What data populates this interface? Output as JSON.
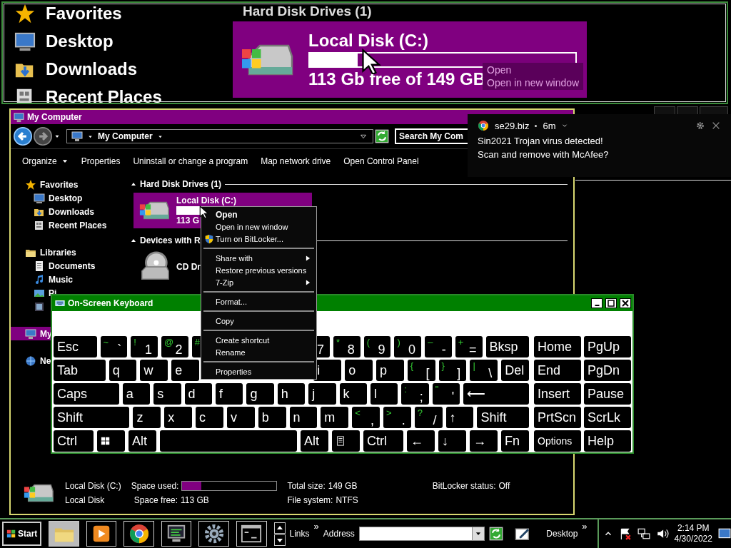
{
  "magnifier": {
    "sidebar": [
      {
        "label": "Favorites",
        "kind": "star"
      },
      {
        "label": "Desktop",
        "kind": "desktop"
      },
      {
        "label": "Downloads",
        "kind": "downloads"
      },
      {
        "label": "Recent Places",
        "kind": "recent"
      }
    ],
    "group": "Hard Disk Drives (1)",
    "drive": {
      "name": "Local Disk (C:)",
      "level": 0.18,
      "free": "113 Gb free of 149 GB"
    },
    "ghost_menu": [
      "Open",
      "Open in new window"
    ]
  },
  "explorer": {
    "title": "My Computer",
    "address": "My Computer",
    "search": {
      "placeholder": "Search My Com"
    },
    "toolbar": [
      {
        "label": "Organize",
        "dropdown": true
      },
      {
        "label": "Properties",
        "dropdown": false
      },
      {
        "label": "Uninstall or change a program",
        "dropdown": false
      },
      {
        "label": "Map network drive",
        "dropdown": false
      },
      {
        "label": "Open Control Panel",
        "dropdown": false
      }
    ],
    "sidebar": [
      {
        "label": "Favorites",
        "kind": "star",
        "selected": false,
        "children": [
          {
            "label": "Desktop",
            "kind": "desktop",
            "selected": false
          },
          {
            "label": "Downloads",
            "kind": "downloads",
            "selected": false
          },
          {
            "label": "Recent Places",
            "kind": "recent",
            "selected": false
          }
        ]
      },
      {
        "label": "Libraries",
        "kind": "libraries",
        "selected": false,
        "children": [
          {
            "label": "Documents",
            "kind": "documents",
            "selected": false
          },
          {
            "label": "Music",
            "kind": "music",
            "selected": false
          },
          {
            "label": "Pi",
            "kind": "pictures",
            "selected": false
          },
          {
            "kind": "videos",
            "selected": false
          }
        ]
      },
      {
        "label": "My",
        "kind": "computer",
        "selected": true
      },
      {
        "label": "Ne",
        "kind": "network",
        "selected": false
      }
    ],
    "groups": [
      {
        "title": "Hard Disk Drives (1)",
        "items": [
          {
            "name": "Local Disk (C:)",
            "kind": "hdd",
            "selected": true,
            "level": 0.2,
            "free": "113 G"
          }
        ]
      },
      {
        "title": "Devices with R",
        "items": [
          {
            "name": "CD Dr",
            "kind": "cd",
            "selected": false
          }
        ]
      }
    ],
    "details": {
      "name": "Local Disk (C:)",
      "type": "Local Disk",
      "used_label": "Space used:",
      "level": 0.2,
      "free_label": "Space free:",
      "free": "113 GB",
      "total_label": "Total size:",
      "total": "149 GB",
      "fs_label": "File system:",
      "fs": "NTFS",
      "bitlocker_label": "BitLocker status:",
      "bitlocker": "Off"
    }
  },
  "notification": {
    "source": "se29.biz",
    "time": "6m",
    "lines": [
      "Sin2021 Trojan virus detected!",
      "Scan and remove with McAfee?"
    ]
  },
  "context_menu": [
    [
      {
        "label": "Open",
        "bold": true,
        "submenu": false,
        "kind": "plain"
      },
      {
        "label": "Open in new window",
        "bold": false,
        "submenu": false,
        "kind": "plain"
      },
      {
        "label": "Turn on BitLocker...",
        "bold": false,
        "submenu": false,
        "kind": "shield"
      }
    ],
    [
      {
        "label": "Share with",
        "bold": false,
        "submenu": true,
        "kind": "plain"
      },
      {
        "label": "Restore previous versions",
        "bold": false,
        "submenu": false,
        "kind": "plain"
      },
      {
        "label": "7-Zip",
        "bold": false,
        "submenu": true,
        "kind": "plain"
      }
    ],
    [
      {
        "label": "Format...",
        "bold": false,
        "submenu": false,
        "kind": "plain"
      }
    ],
    [
      {
        "label": "Copy",
        "bold": false,
        "submenu": false,
        "kind": "plain"
      }
    ],
    [
      {
        "label": "Create shortcut",
        "bold": false,
        "submenu": false,
        "kind": "plain"
      },
      {
        "label": "Rename",
        "bold": false,
        "submenu": false,
        "kind": "plain"
      }
    ],
    [
      {
        "label": "Properties",
        "bold": false,
        "submenu": false,
        "kind": "plain"
      }
    ]
  ],
  "keyboard": {
    "title": "On-Screen Keyboard",
    "rows": [
      {
        "keys": [
          {
            "label": "Esc",
            "kind": "wide"
          },
          {
            "label": "`",
            "shift": "~",
            "kind": "key"
          },
          {
            "label": "1",
            "shift": "!",
            "kind": "key"
          },
          {
            "label": "2",
            "shift": "@",
            "kind": "key"
          },
          {
            "shift": "#",
            "kind": "key"
          },
          {
            "kind": "covered"
          },
          {
            "kind": "covered"
          },
          {
            "kind": "covered"
          },
          {
            "label": "7",
            "kind": "shifted"
          },
          {
            "label": "8",
            "shift": "*",
            "kind": "key"
          },
          {
            "label": "9",
            "shift": "(",
            "kind": "key"
          },
          {
            "label": "0",
            "shift": ")",
            "kind": "key"
          },
          {
            "label": "-",
            "shift": "–",
            "kind": "key"
          },
          {
            "label": "=",
            "shift": "+",
            "kind": "key"
          },
          {
            "label": "Bksp",
            "kind": "wide"
          }
        ]
      },
      {
        "keys": [
          {
            "label": "Tab",
            "kind": "tab"
          },
          {
            "label": "q",
            "kind": "key"
          },
          {
            "label": "w",
            "kind": "key"
          },
          {
            "label": "e",
            "kind": "key"
          },
          {
            "kind": "covered"
          },
          {
            "kind": "covered"
          },
          {
            "kind": "covered"
          },
          {
            "kind": "covered"
          },
          {
            "label": "i",
            "kind": "key"
          },
          {
            "label": "o",
            "kind": "key"
          },
          {
            "label": "p",
            "kind": "key"
          },
          {
            "label": "[",
            "shift": "{",
            "kind": "key"
          },
          {
            "label": "]",
            "shift": "}",
            "kind": "key"
          },
          {
            "label": "\\",
            "shift": "|",
            "kind": "key"
          },
          {
            "label": "Del",
            "kind": "key"
          }
        ]
      },
      {
        "keys": [
          {
            "label": "Caps",
            "kind": "caps"
          },
          {
            "label": "a",
            "kind": "key"
          },
          {
            "label": "s",
            "kind": "key"
          },
          {
            "label": "d",
            "kind": "key"
          },
          {
            "label": "f",
            "kind": "key"
          },
          {
            "label": "g",
            "kind": "key"
          },
          {
            "label": "h",
            "kind": "key"
          },
          {
            "label": "j",
            "kind": "key"
          },
          {
            "label": "k",
            "kind": "key"
          },
          {
            "label": "l",
            "kind": "key"
          },
          {
            "label": ";",
            "shift": ":",
            "kind": "key"
          },
          {
            "label": "'",
            "shift": "\"",
            "kind": "key"
          },
          {
            "label": "⟵",
            "kind": "caps"
          }
        ]
      },
      {
        "keys": [
          {
            "label": "Shift",
            "kind": "lshift"
          },
          {
            "label": "z",
            "kind": "key"
          },
          {
            "label": "x",
            "kind": "key"
          },
          {
            "label": "c",
            "kind": "key"
          },
          {
            "label": "v",
            "kind": "key"
          },
          {
            "label": "b",
            "kind": "key"
          },
          {
            "label": "n",
            "kind": "key"
          },
          {
            "label": "m",
            "kind": "key"
          },
          {
            "label": ",",
            "shift": "<",
            "kind": "key"
          },
          {
            "label": ".",
            "shift": ">",
            "kind": "key"
          },
          {
            "label": "/",
            "shift": "?",
            "kind": "key"
          },
          {
            "label": "↑",
            "kind": "key"
          },
          {
            "label": "Shift",
            "kind": "rshift"
          }
        ]
      },
      {
        "keys": [
          {
            "label": "Ctrl",
            "kind": "mid"
          },
          {
            "kind": "windows"
          },
          {
            "label": "Alt",
            "kind": "key"
          },
          {
            "kind": "space"
          },
          {
            "label": "Alt",
            "kind": "key"
          },
          {
            "kind": "menu"
          },
          {
            "label": "Ctrl",
            "kind": "mid"
          },
          {
            "label": "←",
            "kind": "key"
          },
          {
            "label": "↓",
            "kind": "key"
          },
          {
            "label": "→",
            "kind": "key"
          },
          {
            "label": "Fn",
            "kind": "key"
          }
        ]
      }
    ],
    "side": [
      {
        "label": "Home",
        "kind": "key"
      },
      {
        "label": "PgUp",
        "kind": "key"
      },
      {
        "label": "End",
        "kind": "key"
      },
      {
        "label": "PgDn",
        "kind": "key"
      },
      {
        "label": "Insert",
        "kind": "key"
      },
      {
        "label": "Pause",
        "kind": "key"
      },
      {
        "label": "PrtScn",
        "kind": "key"
      },
      {
        "label": "ScrLk",
        "kind": "key"
      },
      {
        "label": "Options",
        "kind": "small"
      },
      {
        "label": "Help",
        "kind": "key"
      }
    ]
  },
  "taskbar": {
    "start": "Start",
    "apps": [
      {
        "kind": "explorer",
        "selected": true
      },
      {
        "kind": "media",
        "selected": false
      },
      {
        "kind": "chrome",
        "selected": false
      },
      {
        "kind": "monitor",
        "selected": false
      },
      {
        "kind": "gear",
        "selected": false
      },
      {
        "kind": "cmd",
        "selected": false
      }
    ],
    "links": "Links",
    "links_more": "»",
    "address_label": "Address",
    "desktop": "Desktop",
    "desktop_more": "»",
    "time": "2:14 PM",
    "date": "4/30/2022"
  }
}
